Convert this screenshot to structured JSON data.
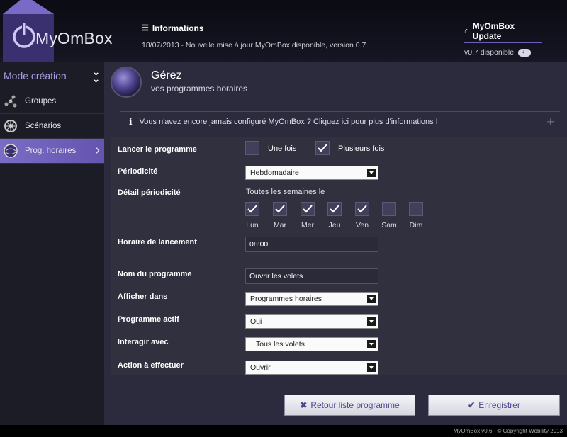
{
  "app": {
    "name": "MyOmBox",
    "footer": "MyOmBox v0.6  -  © Copyright Wobility 2013"
  },
  "header": {
    "info_title": "Informations",
    "info_text": "18/07/2013 - Nouvelle mise à jour MyOmBox disponible, version 0.7",
    "update_title": "MyOmBox Update",
    "update_version": "v0.7 disponible"
  },
  "sidebar": {
    "mode_label": "Mode création",
    "items": [
      {
        "label": "Groupes",
        "icon": "groups-icon",
        "active": false
      },
      {
        "label": "Scénarios",
        "icon": "scenarios-icon",
        "active": false
      },
      {
        "label": "Prog. horaires",
        "icon": "schedules-icon",
        "active": true
      }
    ]
  },
  "page": {
    "title": "Gérez",
    "subtitle": "vos programmes horaires",
    "notice": "Vous n'avez encore jamais configuré MyOmBox ? Cliquez ici pour plus d'informations !"
  },
  "form": {
    "launch_label": "Lancer le programme",
    "launch_options": [
      {
        "label": "Une fois",
        "checked": false
      },
      {
        "label": "Plusieurs fois",
        "checked": true
      }
    ],
    "periodicity_label": "Périodicité",
    "periodicity_value": "Hebdomadaire",
    "detail_label": "Détail périodicité",
    "detail_text": "Toutes les semaines le",
    "days": [
      {
        "label": "Lun",
        "checked": true
      },
      {
        "label": "Mar",
        "checked": true
      },
      {
        "label": "Mer",
        "checked": true
      },
      {
        "label": "Jeu",
        "checked": true
      },
      {
        "label": "Ven",
        "checked": true
      },
      {
        "label": "Sam",
        "checked": false
      },
      {
        "label": "Dim",
        "checked": false
      }
    ],
    "time_label": "Horaire de lancement",
    "time_value": "08:00",
    "name_label": "Nom du programme",
    "name_value": "Ouvrir les volets",
    "display_label": "Afficher dans",
    "display_value": "Programmes horaires",
    "active_label": "Programme actif",
    "active_value": "Oui",
    "interact_label": "Interagir avec",
    "interact_value": "Tous les volets",
    "action_label": "Action à effectuer",
    "action_value": "Ouvrir"
  },
  "buttons": {
    "back_label": "Retour liste programme",
    "save_label": "Enregistrer"
  },
  "colors": {
    "accent": "#6d5fb8",
    "active_nav": "#6554b0",
    "main_bg": "#2c2b3d"
  }
}
